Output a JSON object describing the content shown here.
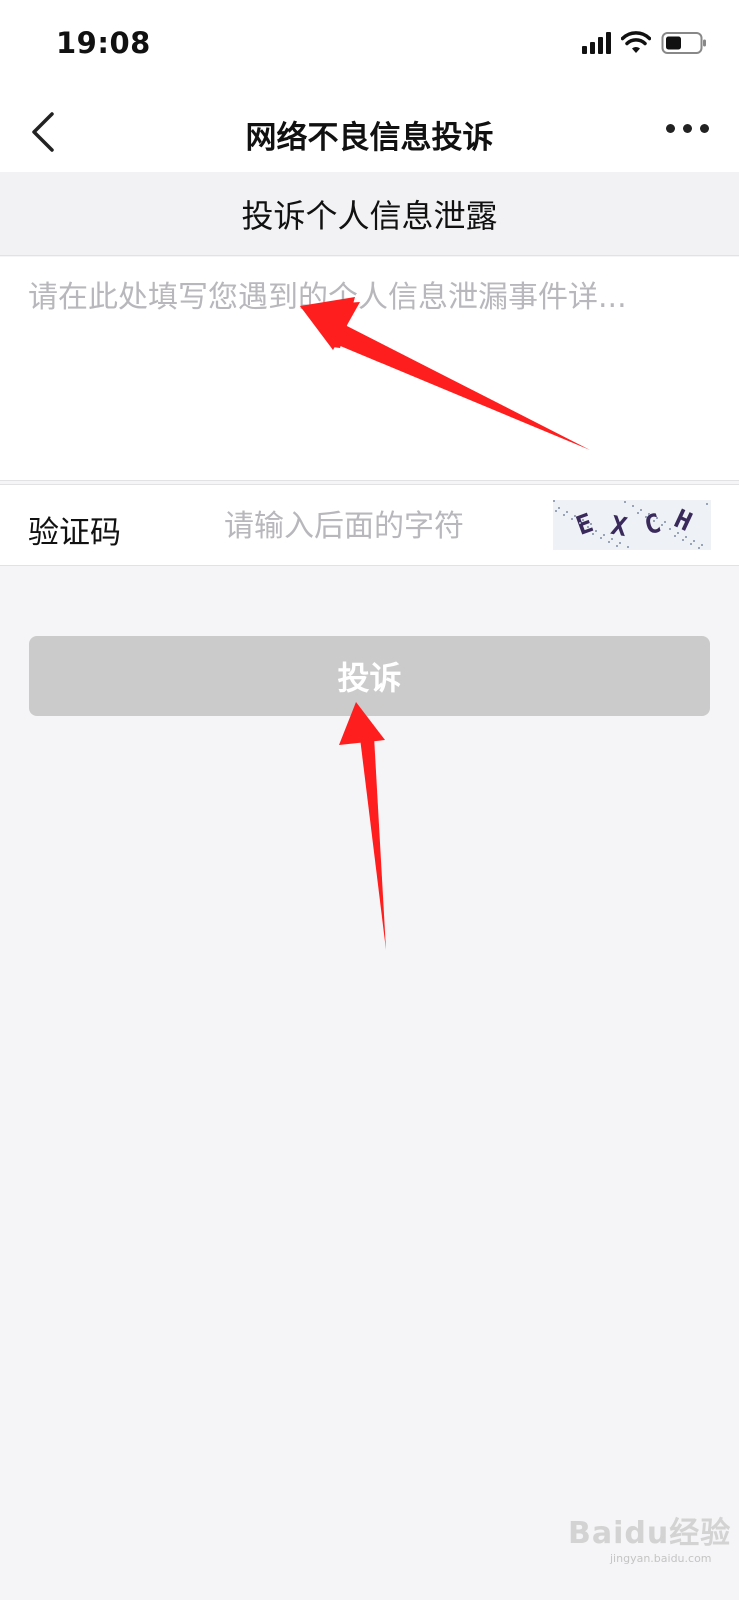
{
  "status_bar": {
    "time": "19:08"
  },
  "nav": {
    "title": "网络不良信息投诉"
  },
  "section": {
    "title": "投诉个人信息泄露"
  },
  "detail": {
    "placeholder": "请在此处填写您遇到的个人信息泄漏事件详..."
  },
  "captcha": {
    "label": "验证码",
    "placeholder": "请输入后面的字符",
    "image_text": "EXCH"
  },
  "submit": {
    "label": "投诉"
  },
  "watermark": {
    "brand": "Baidu经验",
    "url": "jingyan.baidu.com"
  },
  "colors": {
    "annotation_arrow": "#ff1e1e",
    "button_disabled": "#cbcbcb",
    "page_bg": "#f5f5f7"
  },
  "icons": [
    "back-icon",
    "more-icon",
    "signal-icon",
    "wifi-icon",
    "battery-icon"
  ]
}
